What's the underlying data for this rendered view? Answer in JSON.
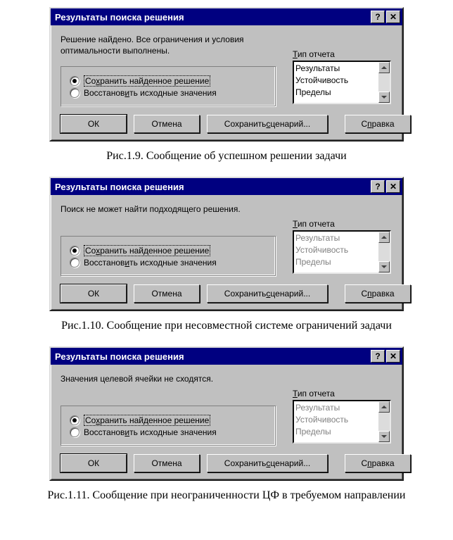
{
  "common": {
    "dialog_title": "Результаты поиска решения",
    "help_glyph": "?",
    "close_glyph": "✕",
    "report_label_html": "<u>Т</u>ип отчета",
    "report_items": [
      "Результаты",
      "Устойчивость",
      "Пределы"
    ],
    "radio_keep_html": "Со<u>х</u>ранить найденное решение",
    "radio_restore_html": "Восстанов<u>и</u>ть исходные значения",
    "btn_ok": "ОК",
    "btn_cancel": "Отмена",
    "btn_save_scenario_html": "Сохранить <u>с</u>ценарий...",
    "btn_help_html": "С<u>п</u>равка"
  },
  "figures": [
    {
      "message": "Решение найдено. Все ограничения и условия оптимальности выполнены.",
      "options_disabled": false,
      "caption": "Рис.1.9. Сообщение об успешном решении задачи"
    },
    {
      "message": "Поиск не может найти подходящего решения.",
      "options_disabled": true,
      "caption": "Рис.1.10. Сообщение при несовместной системе ограничений задачи"
    },
    {
      "message": "Значения целевой ячейки не сходятся.",
      "options_disabled": true,
      "caption": "Рис.1.11. Сообщение при неограниченности ЦФ в требуемом направлении"
    }
  ]
}
